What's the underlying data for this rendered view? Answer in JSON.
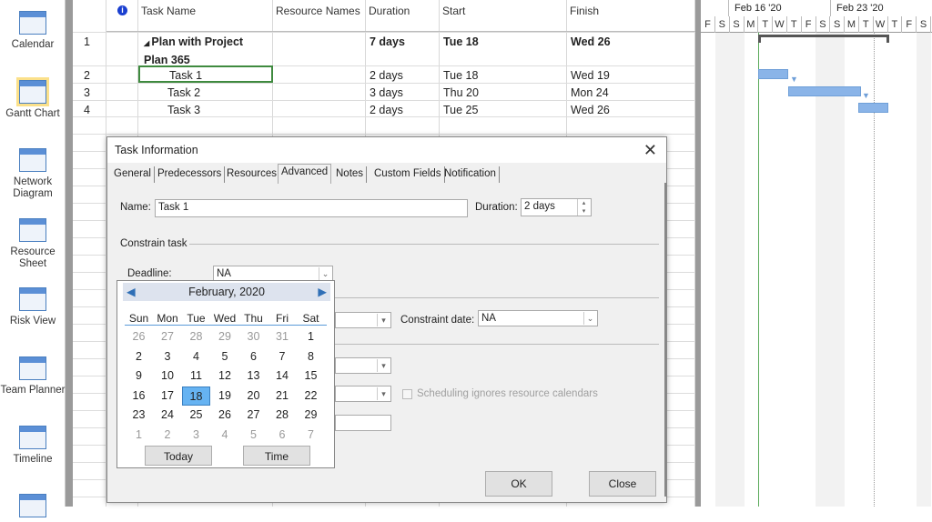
{
  "sidebar": {
    "items": [
      {
        "label": "Calendar"
      },
      {
        "label": "Gantt Chart",
        "selected": true
      },
      {
        "label": "Network Diagram"
      },
      {
        "label": "Resource Sheet"
      },
      {
        "label": "Risk View"
      },
      {
        "label": "Team Planner"
      },
      {
        "label": "Timeline"
      }
    ]
  },
  "table": {
    "headers": {
      "info": "i",
      "name": "Task Name",
      "resources": "Resource Names",
      "duration": "Duration",
      "start": "Start",
      "finish": "Finish"
    },
    "rows": [
      {
        "id": "1",
        "name": "Plan with Project Plan 365",
        "resources": "",
        "duration": "7 days",
        "start": "Tue 18",
        "finish": "Wed 26",
        "summary": true
      },
      {
        "id": "2",
        "name": "Task 1",
        "resources": "",
        "duration": "2 days",
        "start": "Tue 18",
        "finish": "Wed 19"
      },
      {
        "id": "3",
        "name": "Task 2",
        "resources": "",
        "duration": "3 days",
        "start": "Thu 20",
        "finish": "Mon 24"
      },
      {
        "id": "4",
        "name": "Task 3",
        "resources": "",
        "duration": "2 days",
        "start": "Tue 25",
        "finish": "Wed 26"
      }
    ]
  },
  "gantt": {
    "weeks": [
      "Feb 16 '20",
      "Feb 23 '20"
    ],
    "days": [
      "F",
      "S",
      "S",
      "M",
      "T",
      "W",
      "T",
      "F",
      "S",
      "S",
      "M",
      "T",
      "W",
      "T",
      "F",
      "S"
    ],
    "bar_color": "#8ab4e8"
  },
  "dialog": {
    "title": "Task Information",
    "tabs": [
      "General",
      "Predecessors",
      "Resources",
      "Advanced",
      "Notes",
      "Custom Fields",
      "Notification"
    ],
    "active_tab": "Advanced",
    "name_label": "Name:",
    "name_value": "Task 1",
    "duration_label": "Duration:",
    "duration_value": "2 days",
    "constrain_label": "Constrain task",
    "deadline_label": "Deadline:",
    "deadline_value": "NA",
    "constraint_date_label": "Constraint date:",
    "constraint_date_value": "NA",
    "ignore_calendars_label": "Scheduling ignores resource calendars",
    "ok": "OK",
    "close": "Close"
  },
  "calendar": {
    "month": "February, 2020",
    "dow": [
      "Sun",
      "Mon",
      "Tue",
      "Wed",
      "Thu",
      "Fri",
      "Sat"
    ],
    "weeks": [
      [
        "26",
        "27",
        "28",
        "29",
        "30",
        "31",
        "1"
      ],
      [
        "2",
        "3",
        "4",
        "5",
        "6",
        "7",
        "8"
      ],
      [
        "9",
        "10",
        "11",
        "12",
        "13",
        "14",
        "15"
      ],
      [
        "16",
        "17",
        "18",
        "19",
        "20",
        "21",
        "22"
      ],
      [
        "23",
        "24",
        "25",
        "26",
        "27",
        "28",
        "29"
      ],
      [
        "1",
        "2",
        "3",
        "4",
        "5",
        "6",
        "7"
      ]
    ],
    "selected": "18",
    "today_label": "Today",
    "time_label": "Time"
  }
}
